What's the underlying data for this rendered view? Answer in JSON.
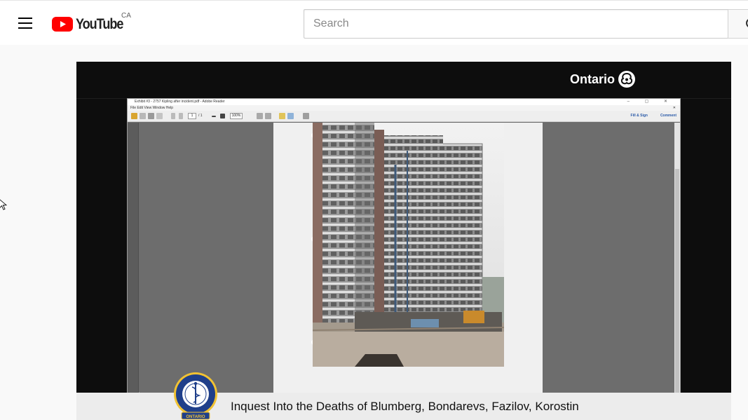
{
  "header": {
    "brand": "YouTube",
    "country": "CA",
    "search_placeholder": "Search"
  },
  "video": {
    "broadcaster": "Ontario",
    "caption": "Inquest Into the Deaths of Blumberg, Bondarevs, Fazilov, Korostin",
    "seal_text": "ONTARIO",
    "reader": {
      "title": "Exhibit #3 - 2757 Kipling after incident.pdf - Adobe Reader",
      "window_controls": "– ▢ ✕",
      "menu": "File  Edit  View  Window  Help",
      "page_number": "1",
      "page_total": "/ 1",
      "zoom": "100%",
      "fill_sign": "Fill & Sign",
      "comment": "Comment"
    }
  },
  "colors": {
    "youtube_red": "#ff0000",
    "player_bg": "#0d0d0d",
    "caption_bg": "#ececec"
  },
  "icons": {
    "menu": "hamburger-icon",
    "search": "search-icon",
    "logo": "youtube-play-icon",
    "ontario": "ontario-trillium-icon",
    "seal": "coroner-seal-icon",
    "cursor": "mouse-cursor-icon"
  }
}
